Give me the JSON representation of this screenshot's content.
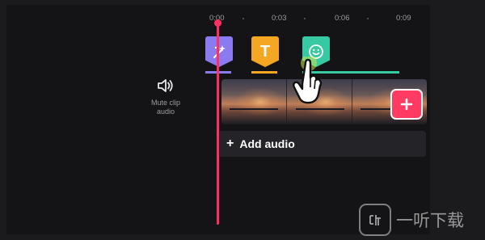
{
  "timeline": {
    "ruler": [
      "0:00",
      "0:03",
      "0:06",
      "0:09"
    ]
  },
  "mute": {
    "icon": "speaker-icon",
    "label_line1": "Mute clip",
    "label_line2": "audio"
  },
  "overlays": [
    {
      "name": "effect",
      "icon": "magic-wand-icon",
      "color": "#8a7bf0"
    },
    {
      "name": "text",
      "label": "T",
      "color": "#f5a623"
    },
    {
      "name": "sticker",
      "icon": "smiley-icon",
      "color": "#36c9a2"
    }
  ],
  "add_clip": {
    "icon": "plus-icon",
    "color": "#ff3a63"
  },
  "add_audio": {
    "plus": "+",
    "label": "Add audio"
  },
  "playhead_color": "#ff2e5e",
  "watermark": {
    "text": "一听下载"
  }
}
